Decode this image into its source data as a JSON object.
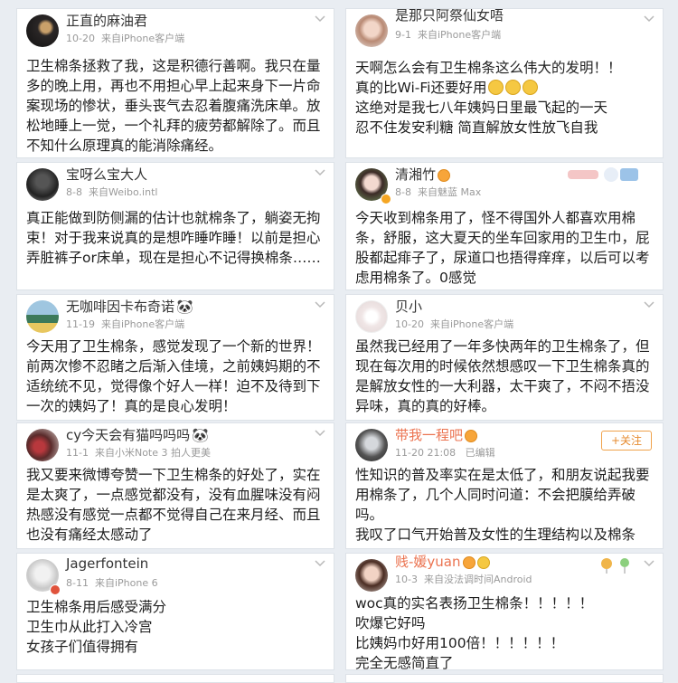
{
  "posts": [
    {
      "user": "正直的麻油君",
      "time": "10-20",
      "source": "来自iPhone客户端",
      "text": "卫生棉条拯救了我，这是积德行善啊。我只在量多的晚上用，再也不用担心早上起来身下一片命案现场的惨状，垂头丧气去忍着腹痛洗床单。放松地睡上一觉，一个礼拜的疲劳都解除了。而且不知什么原理真的能消除痛经。"
    },
    {
      "user": "是那只阿祭仙女唔",
      "time": "9-1",
      "source": "来自iPhone客户端",
      "line1": "天啊怎么会有卫生棉条这么伟大的发明！！",
      "line2": "真的比Wi-Fi还要好用",
      "line3": "这绝对是我七八年姨妈日里最飞起的一天",
      "line4": "忍不住发安利糖 简直解放女性放飞自我"
    },
    {
      "user": "宝呀么宝大人",
      "time": "8-8",
      "source": "来自Weibo.intl",
      "text": "真正能做到防侧漏的估计也就棉条了，躺姿无拘束！对于我来说真的是想咋睡咋睡！以前是担心弄脏裤子or床单，现在是担心不记得换棉条……"
    },
    {
      "user": "清湘竹",
      "time": "8-8",
      "source": "来自魅蓝 Max",
      "text": "今天收到棉条用了，怪不得国外人都喜欢用棉条，舒服，这大夏天的坐车回家用的卫生巾，屁股都起痱子了，尿道口也捂得痒痒，以后可以考虑用棉条了。0感觉"
    },
    {
      "user": "无咖啡因卡布奇诺",
      "time": "11-19",
      "source": "来自iPhone客户端",
      "text": "今天用了卫生棉条，感觉发现了一个新的世界！前两次惨不忍睹之后渐入佳境，之前姨妈期的不适统统不见，觉得像个好人一样！迫不及待到下一次的姨妈了！真的是良心发明！"
    },
    {
      "user": "贝小",
      "time": "10-20",
      "source": "来自iPhone客户端",
      "text": "虽然我已经用了一年多快两年的卫生棉条了，但现在每次用的时候依然想感叹一下卫生棉条真的是解放女性的一大利器，太干爽了，不闷不捂没异味，真的真的好棒。"
    },
    {
      "user": "cy今天会有猫吗吗吗",
      "time": "11-1",
      "source": "来自小米Note 3 拍人更美",
      "text": "我又要来微博夸赞一下卫生棉条的好处了，实在是太爽了，一点感觉都没有，没有血腥味没有闷热感没有感觉一点都不觉得自己在来月经、而且也没有痛经太感动了"
    },
    {
      "user": "带我一程吧",
      "time": "11-20 21:08",
      "source": "已编辑",
      "follow": "+关注",
      "line1": "性知识的普及率实在是太低了，和朋友说起我要用棉条了，几个人同时问道：不会把膜给弄破吗。",
      "line2": "我叹了口气开始普及女性的生理结构以及棉条"
    },
    {
      "user": "Jagerfontein",
      "time": "8-11",
      "source": "来自iPhone 6",
      "line1": "卫生棉条用后感受满分",
      "line2": "卫生巾从此打入冷宫",
      "line3": "女孩子们值得拥有"
    },
    {
      "user": "贱-媛yuan",
      "time": "10-3",
      "source": "来自没法调时间Android",
      "line1": "woc真的实名表扬卫生棉条！！！！！",
      "line2": "吹爆它好吗",
      "line3": "比姨妈巾好用100倍！！！！！！",
      "line4": "完全无感简直了"
    }
  ],
  "icons": {
    "chevron": "chevron-down-icon",
    "emoji": "smile-emoji-icon",
    "panda": "panda-emoji-icon",
    "vip": "vip-badge-icon"
  },
  "colors": {
    "background": "#e9edf2",
    "card": "#ffffff",
    "meta": "#9a9a9a",
    "vipName": "#eb7350",
    "follow": "#e68a2e"
  }
}
